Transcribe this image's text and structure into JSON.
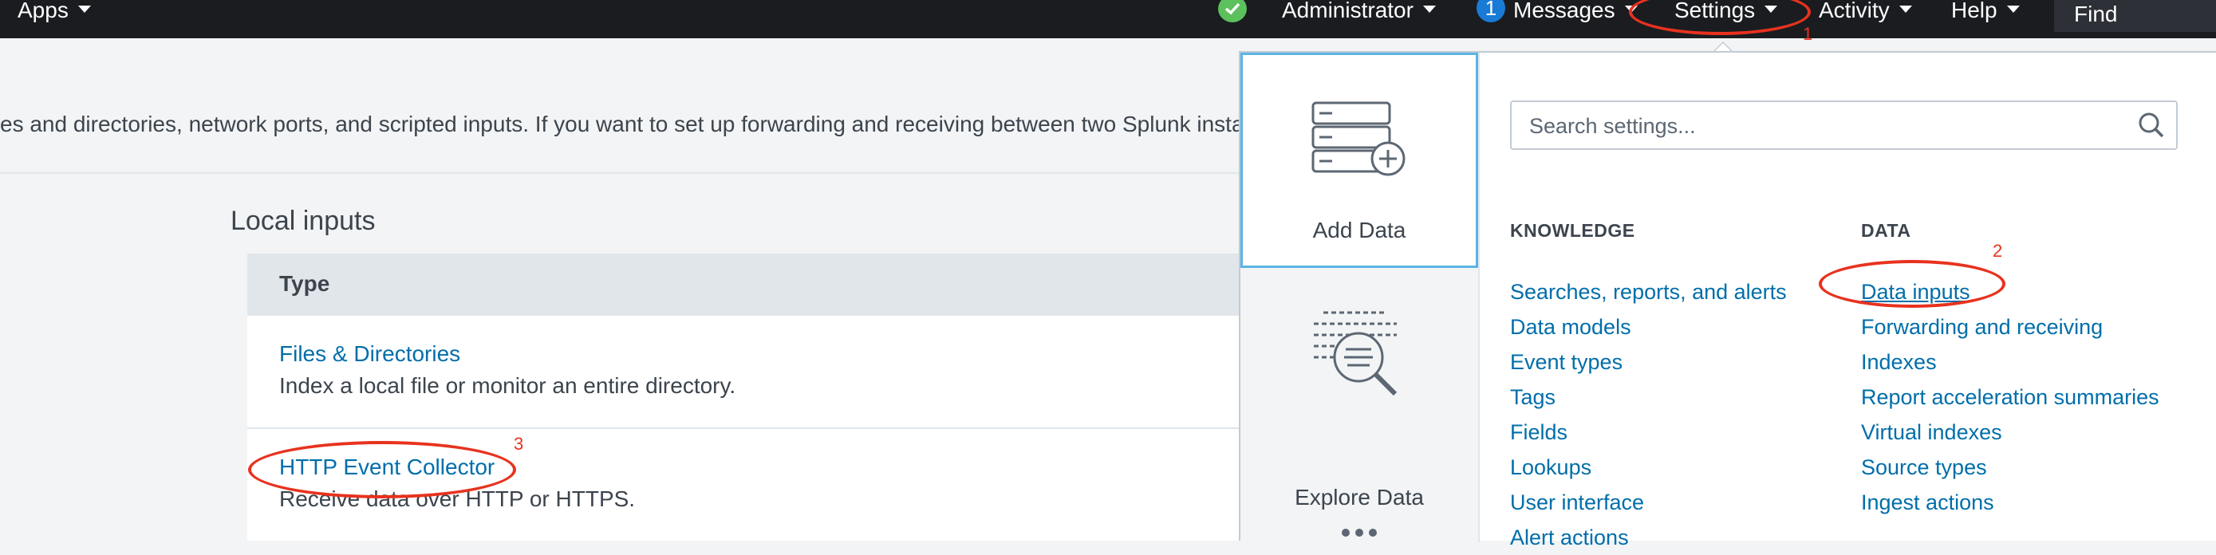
{
  "topbar": {
    "apps_label": "Apps",
    "user_label": "Administrator",
    "messages_count": "1",
    "messages_label": "Messages",
    "settings_label": "Settings",
    "activity_label": "Activity",
    "help_label": "Help",
    "find_label": "Find"
  },
  "page": {
    "intro_text": "es and directories, network ports, and scripted inputs. If you want to set up forwarding and receiving between two Splunk instar",
    "section_title": "Local inputs",
    "table_header": "Type",
    "rows": [
      {
        "title": "Files & Directories",
        "description": "Index a local file or monitor an entire directory."
      },
      {
        "title": "HTTP Event Collector",
        "description": "Receive data over HTTP or HTTPS."
      }
    ]
  },
  "settings_menu": {
    "search_placeholder": "Search settings...",
    "tiles": [
      {
        "label": "Add Data",
        "icon": "add-data-icon"
      },
      {
        "label": "Explore Data",
        "icon": "explore-data-icon"
      }
    ],
    "knowledge_heading": "KNOWLEDGE",
    "knowledge_items": [
      "Searches, reports, and alerts",
      "Data models",
      "Event types",
      "Tags",
      "Fields",
      "Lookups",
      "User interface",
      "Alert actions"
    ],
    "data_heading": "DATA",
    "data_items": [
      "Data inputs",
      "Forwarding and receiving",
      "Indexes",
      "Report acceleration summaries",
      "Virtual indexes",
      "Source types",
      "Ingest actions"
    ]
  },
  "annotations": {
    "step1": "1",
    "step2": "2",
    "step3": "3",
    "color": "#e8321e"
  }
}
